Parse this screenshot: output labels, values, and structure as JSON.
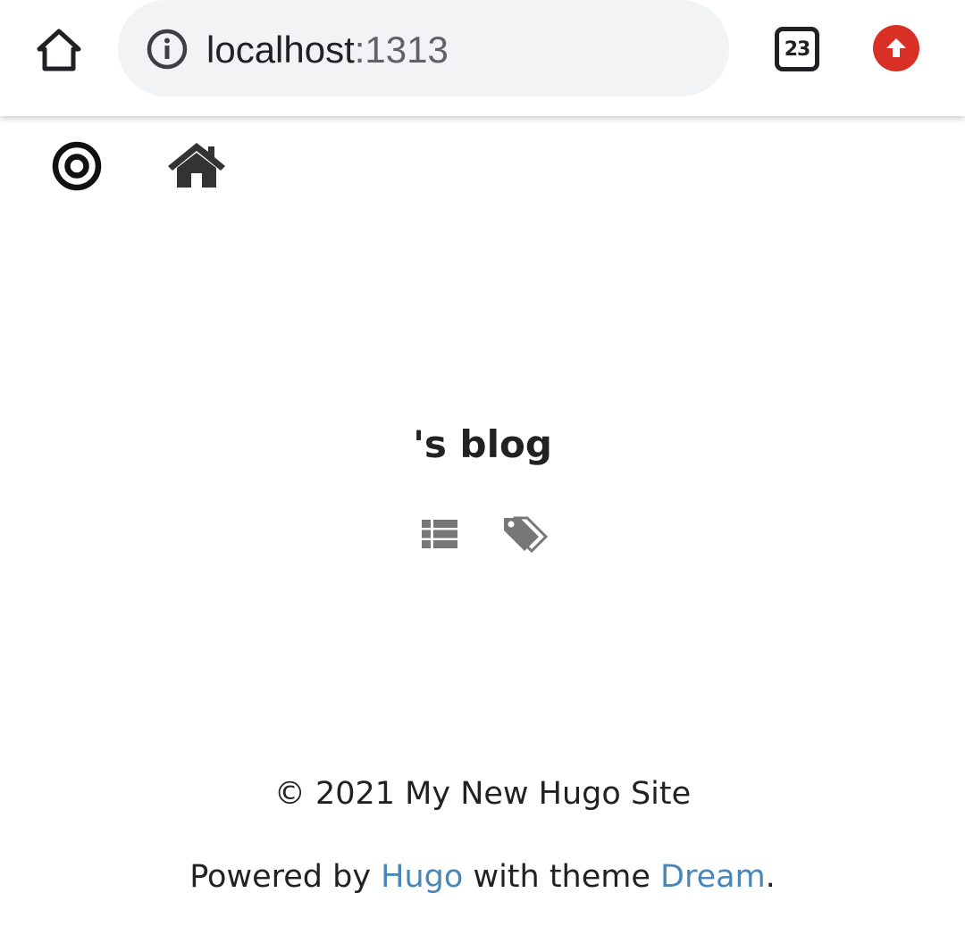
{
  "browser": {
    "url_host": "localhost",
    "url_port": ":1313",
    "tab_count": "23",
    "icons": {
      "home": "home-outline-icon",
      "info": "info-circle-icon",
      "tabs": "tab-switcher-icon",
      "update": "update-arrow-up-icon"
    },
    "colors": {
      "omnibox_bg": "#f1f3f4",
      "update_red": "#d93025"
    }
  },
  "site_nav": {
    "icons": [
      "bullseye-icon",
      "house-icon"
    ]
  },
  "main": {
    "title": "'s blog",
    "icons": [
      "list-icon",
      "tags-icon"
    ]
  },
  "footer": {
    "copyright": "© 2021 My New Hugo Site",
    "powered_prefix": "Powered by ",
    "hugo_link": "Hugo",
    "with_theme": " with theme ",
    "dream_link": "Dream",
    "period": ".",
    "link_color": "#4a87b8"
  }
}
